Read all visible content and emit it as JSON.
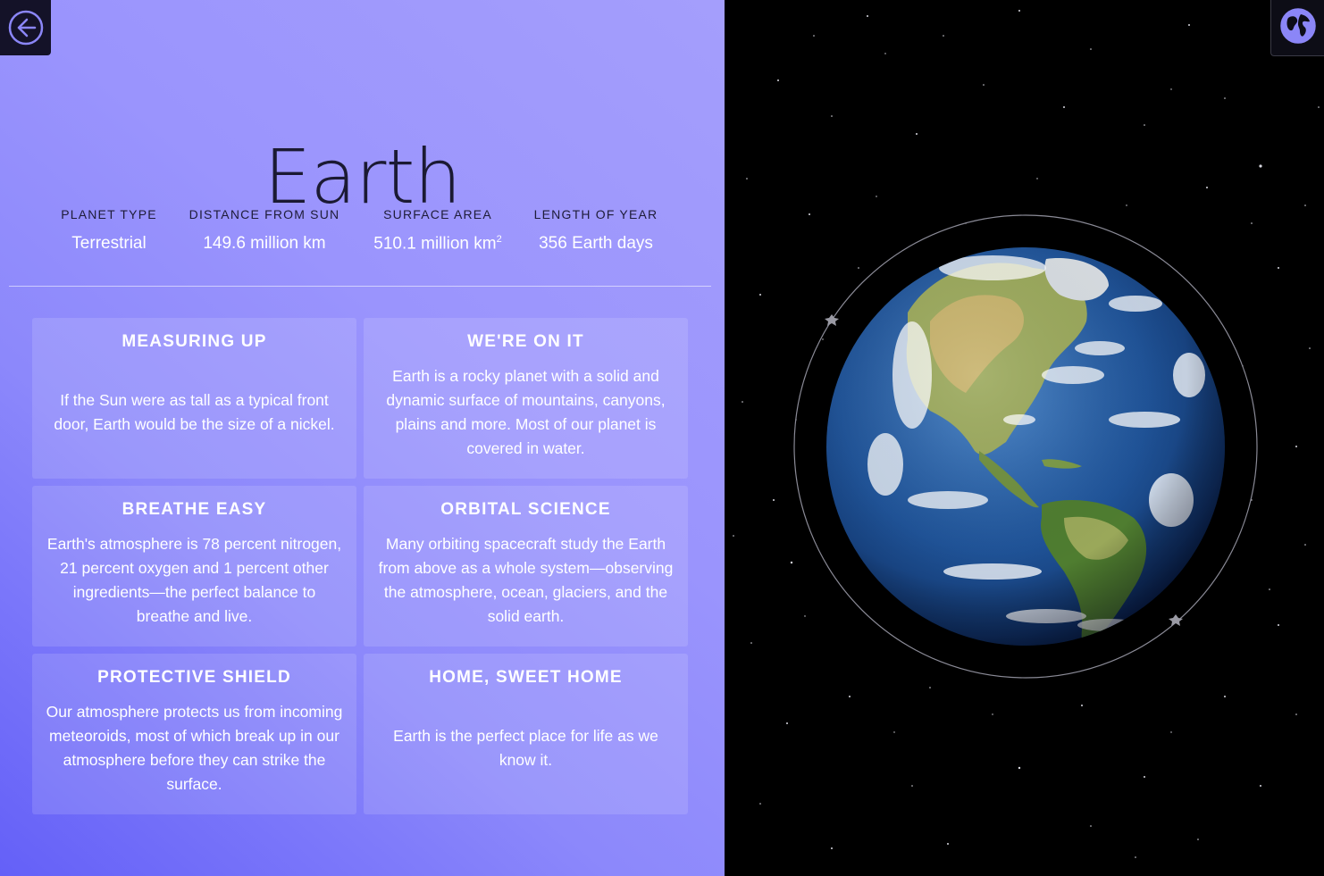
{
  "planet": {
    "name": "Earth"
  },
  "stats": [
    {
      "label": "PLANET TYPE",
      "value": "Terrestrial"
    },
    {
      "label": "DISTANCE FROM SUN",
      "value": "149.6 million km"
    },
    {
      "label": "SURFACE AREA",
      "value": "510.1 million km",
      "unit_sup": "2"
    },
    {
      "label": "LENGTH OF YEAR",
      "value": "356 Earth days"
    }
  ],
  "cards": [
    {
      "title": "MEASURING UP",
      "body": "If the Sun were as tall as a typical front door, Earth would be the size of a nickel."
    },
    {
      "title": "WE'RE ON IT",
      "body": "Earth is a rocky planet with a solid and dynamic surface of mountains, canyons, plains and more. Most of our planet is covered in water."
    },
    {
      "title": "BREATHE EASY",
      "body": "Earth's atmosphere is 78 percent nitrogen, 21 percent oxygen and 1 percent other ingredients—the perfect balance to breathe and live."
    },
    {
      "title": "ORBITAL SCIENCE",
      "body": "Many orbiting spacecraft study the Earth from above as a whole system—observing the atmosphere, ocean, glaciers, and the solid earth."
    },
    {
      "title": "PROTECTIVE SHIELD",
      "body": "Our atmosphere protects us from incoming meteoroids, most of which break up in our atmosphere before they can strike the surface."
    },
    {
      "title": "HOME, SWEET HOME",
      "body": "Earth is the perfect place for life as we know it."
    }
  ],
  "icons": {
    "back": "arrow-left-circle-icon",
    "globe": "globe-icon"
  },
  "colors": {
    "panel_gradient_start": "#6460f8",
    "panel_gradient_end": "#a49efc",
    "title_text": "#1b1a33",
    "space_background": "#000000",
    "back_button_bg": "#141228",
    "icon_accent": "#8b86f7"
  }
}
